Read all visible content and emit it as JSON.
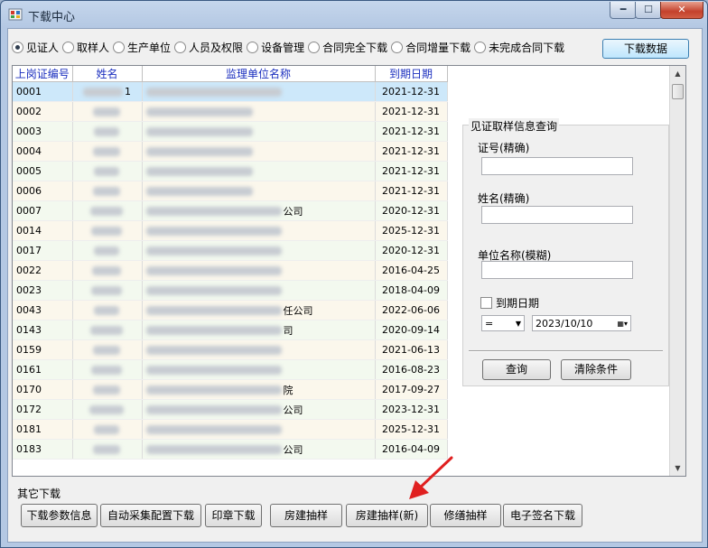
{
  "window": {
    "title": "下载中心",
    "min_glyph": "━",
    "max_glyph": "☐",
    "close_glyph": "✕"
  },
  "tabs": [
    {
      "label": "见证人",
      "selected": true
    },
    {
      "label": "取样人",
      "selected": false
    },
    {
      "label": "生产单位",
      "selected": false
    },
    {
      "label": "人员及权限",
      "selected": false
    },
    {
      "label": "设备管理",
      "selected": false
    },
    {
      "label": "合同完全下载",
      "selected": false
    },
    {
      "label": "合同增量下载",
      "selected": false
    },
    {
      "label": "未完成合同下载",
      "selected": false
    }
  ],
  "download_button": "下载数据",
  "grid": {
    "headers": [
      "上岗证编号",
      "姓名",
      "监理单位名称",
      "到期日期"
    ],
    "rows": [
      {
        "id": "0001",
        "name_tail": "1",
        "unit_tail": "",
        "date": "2021-12-31"
      },
      {
        "id": "0002",
        "name_tail": "",
        "unit_tail": "",
        "date": "2021-12-31"
      },
      {
        "id": "0003",
        "name_tail": "",
        "unit_tail": "",
        "date": "2021-12-31"
      },
      {
        "id": "0004",
        "name_tail": "",
        "unit_tail": "",
        "date": "2021-12-31"
      },
      {
        "id": "0005",
        "name_tail": "",
        "unit_tail": "",
        "date": "2021-12-31"
      },
      {
        "id": "0006",
        "name_tail": "",
        "unit_tail": "",
        "date": "2021-12-31"
      },
      {
        "id": "0007",
        "name_tail": "",
        "unit_tail": "公司",
        "date": "2020-12-31"
      },
      {
        "id": "0014",
        "name_tail": "",
        "unit_tail": "",
        "date": "2025-12-31"
      },
      {
        "id": "0017",
        "name_tail": "",
        "unit_tail": "",
        "date": "2020-12-31"
      },
      {
        "id": "0022",
        "name_tail": "",
        "unit_tail": "",
        "date": "2016-04-25"
      },
      {
        "id": "0023",
        "name_tail": "",
        "unit_tail": "",
        "date": "2018-04-09"
      },
      {
        "id": "0043",
        "name_tail": "",
        "unit_tail": "任公司",
        "date": "2022-06-06"
      },
      {
        "id": "0143",
        "name_tail": "",
        "unit_tail": "司",
        "date": "2020-09-14"
      },
      {
        "id": "0159",
        "name_tail": "",
        "unit_tail": "",
        "date": "2021-06-13"
      },
      {
        "id": "0161",
        "name_tail": "",
        "unit_tail": "",
        "date": "2016-08-23"
      },
      {
        "id": "0170",
        "name_tail": "",
        "unit_tail": "院",
        "date": "2017-09-27"
      },
      {
        "id": "0172",
        "name_tail": "",
        "unit_tail": "公司",
        "date": "2023-12-31"
      },
      {
        "id": "0181",
        "name_tail": "",
        "unit_tail": "",
        "date": "2025-12-31"
      },
      {
        "id": "0183",
        "name_tail": "",
        "unit_tail": "公司",
        "date": "2016-04-09"
      }
    ]
  },
  "query": {
    "legend": "见证取样信息查询",
    "cert_label": "证号(精确)",
    "name_label": "姓名(精确)",
    "unit_label": "单位名称(模糊)",
    "expire_label": "到期日期",
    "operator": "=",
    "date_value": "2023/10/10",
    "search_button": "查询",
    "clear_button": "清除条件"
  },
  "other": {
    "title": "其它下载",
    "buttons": [
      "下载参数信息",
      "自动采集配置下载",
      "印章下载",
      "房建抽样",
      "房建抽样(新)",
      "修缮抽样",
      "电子签名下载"
    ]
  },
  "colors": {
    "annotation_arrow": "#e02020",
    "header_text": "#1b2fbf",
    "selected_row": "#cde8fa"
  }
}
